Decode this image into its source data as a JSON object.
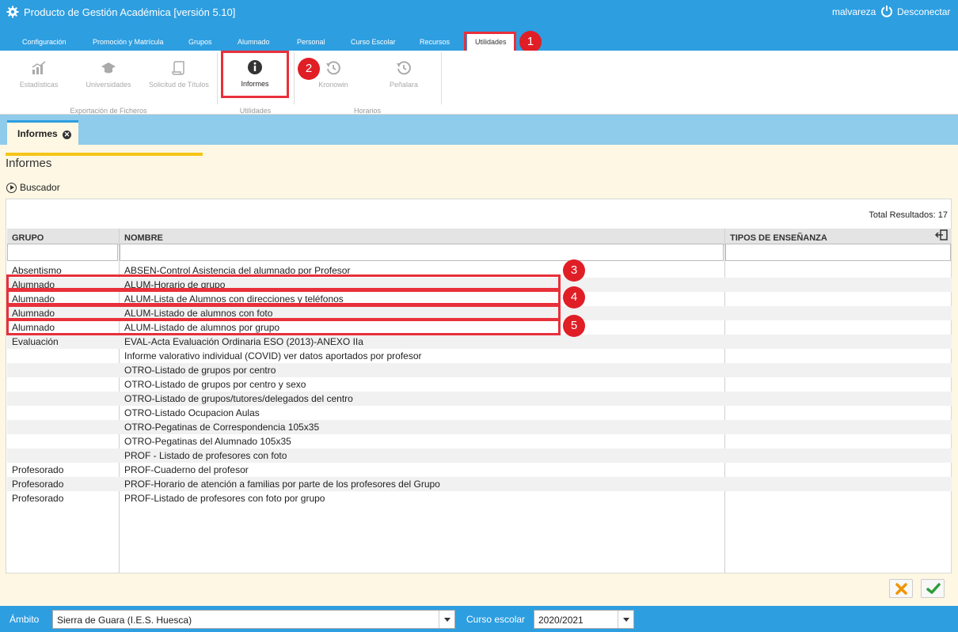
{
  "app": {
    "title": "Producto de Gestión Académica [versión 5.10]",
    "user": "malvareza",
    "logout_label": "Desconectar"
  },
  "menu": {
    "tabs": [
      "Configuración",
      "Promoción y Matrícula",
      "Grupos",
      "Alumnado",
      "Personal",
      "Curso Escolar",
      "Recursos",
      "Utilidades"
    ],
    "active": "Utilidades"
  },
  "ribbon": {
    "items": [
      {
        "label": "Estadísticas",
        "icon": "bar-chart-icon",
        "enabled": false
      },
      {
        "label": "Universidades",
        "icon": "graduation-cap-icon",
        "enabled": false
      },
      {
        "label": "Solicitud de Títulos",
        "icon": "scroll-icon",
        "enabled": false
      },
      {
        "label": "Informes",
        "icon": "info-icon",
        "enabled": true
      },
      {
        "label": "Kronowin",
        "icon": "history-icon",
        "enabled": false
      },
      {
        "label": "Peñalara",
        "icon": "history-icon",
        "enabled": false
      }
    ],
    "groups": [
      "Exportación de Ficheros",
      "Utilidades",
      "Horarios"
    ]
  },
  "doc_tab": {
    "label": "Informes"
  },
  "page": {
    "title": "Informes",
    "search_toggle": "Buscador",
    "total_results": "Total Resultados: 17"
  },
  "table": {
    "columns": [
      "GRUPO",
      "NOMBRE",
      "TIPOS DE ENSEÑANZA"
    ],
    "rows": [
      {
        "grupo": "Absentismo",
        "nombre": "ABSEN-Control Asistencia del alumnado por Profesor"
      },
      {
        "grupo": "Alumnado",
        "nombre": "ALUM-Horario de grupo"
      },
      {
        "grupo": "Alumnado",
        "nombre": "ALUM-Lista de Alumnos con direcciones y teléfonos"
      },
      {
        "grupo": "Alumnado",
        "nombre": "ALUM-Listado de alumnos con foto"
      },
      {
        "grupo": "Alumnado",
        "nombre": "ALUM-Listado de alumnos por grupo"
      },
      {
        "grupo": "Evaluación",
        "nombre": "EVAL-Acta Evaluación Ordinaria ESO (2013)-ANEXO IIa"
      },
      {
        "grupo": "",
        "nombre": "Informe valorativo individual (COVID) ver datos aportados por profesor"
      },
      {
        "grupo": "",
        "nombre": "OTRO-Listado de grupos por centro"
      },
      {
        "grupo": "",
        "nombre": "OTRO-Listado de grupos por centro y sexo"
      },
      {
        "grupo": "",
        "nombre": "OTRO-Listado de grupos/tutores/delegados del centro"
      },
      {
        "grupo": "",
        "nombre": "OTRO-Listado Ocupacion Aulas"
      },
      {
        "grupo": "",
        "nombre": "OTRO-Pegatinas de Correspondencia 105x35"
      },
      {
        "grupo": "",
        "nombre": "OTRO-Pegatinas del Alumnado 105x35"
      },
      {
        "grupo": "",
        "nombre": "PROF - Listado de profesores con foto"
      },
      {
        "grupo": "Profesorado",
        "nombre": "PROF-Cuaderno del profesor"
      },
      {
        "grupo": "Profesorado",
        "nombre": "PROF-Horario de atención a familias por parte de los profesores del Grupo"
      },
      {
        "grupo": "Profesorado",
        "nombre": "PROF-Listado de profesores con foto por grupo"
      }
    ]
  },
  "markers": [
    "1",
    "2",
    "3",
    "4",
    "5"
  ],
  "footer": {
    "ambito_label": "Ámbito",
    "ambito_value": "Sierra de Guara (I.E.S. Huesca)",
    "curso_label": "Curso escolar",
    "curso_value": "2020/2021"
  },
  "colors": {
    "accent": "#2d9ee0",
    "highlight": "#e8303a",
    "marker": "#e01e26",
    "cancel": "#f29400",
    "confirm": "#2e9d3a"
  }
}
